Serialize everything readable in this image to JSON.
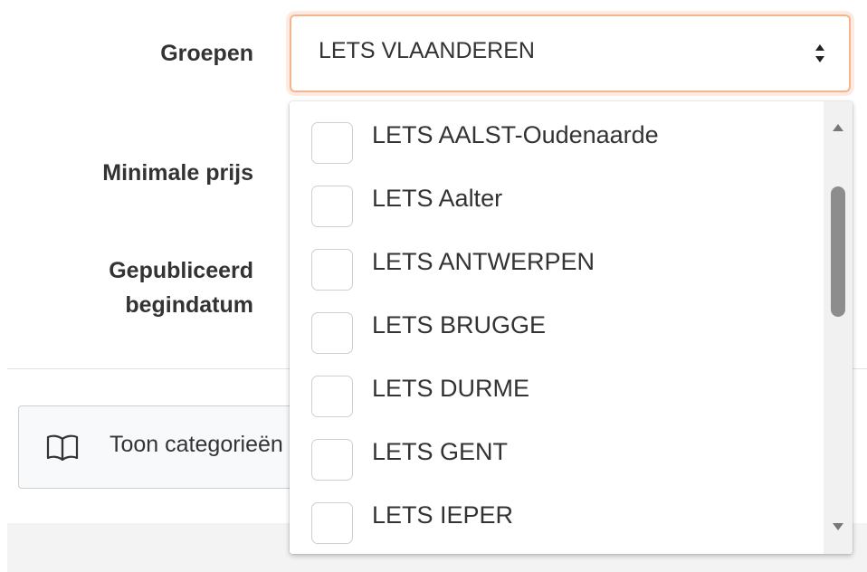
{
  "form": {
    "groepen_label": "Groepen",
    "min_prijs_label": "Minimale prijs",
    "pub_line1": "Gepubliceerd",
    "pub_line2": "begindatum"
  },
  "select": {
    "value": "LETS VLAANDEREN"
  },
  "dropdown": {
    "options": [
      "LETS AALST-Oudenaarde",
      "LETS Aalter",
      "LETS ANTWERPEN",
      "LETS BRUGGE",
      "LETS DURME",
      "LETS GENT",
      "LETS IEPER"
    ]
  },
  "category_button": {
    "label": "Toon categorieën",
    "icon": "book-icon"
  },
  "colors": {
    "focus_border": "#f3b58f",
    "scroll_thumb": "#8d8d8d"
  }
}
